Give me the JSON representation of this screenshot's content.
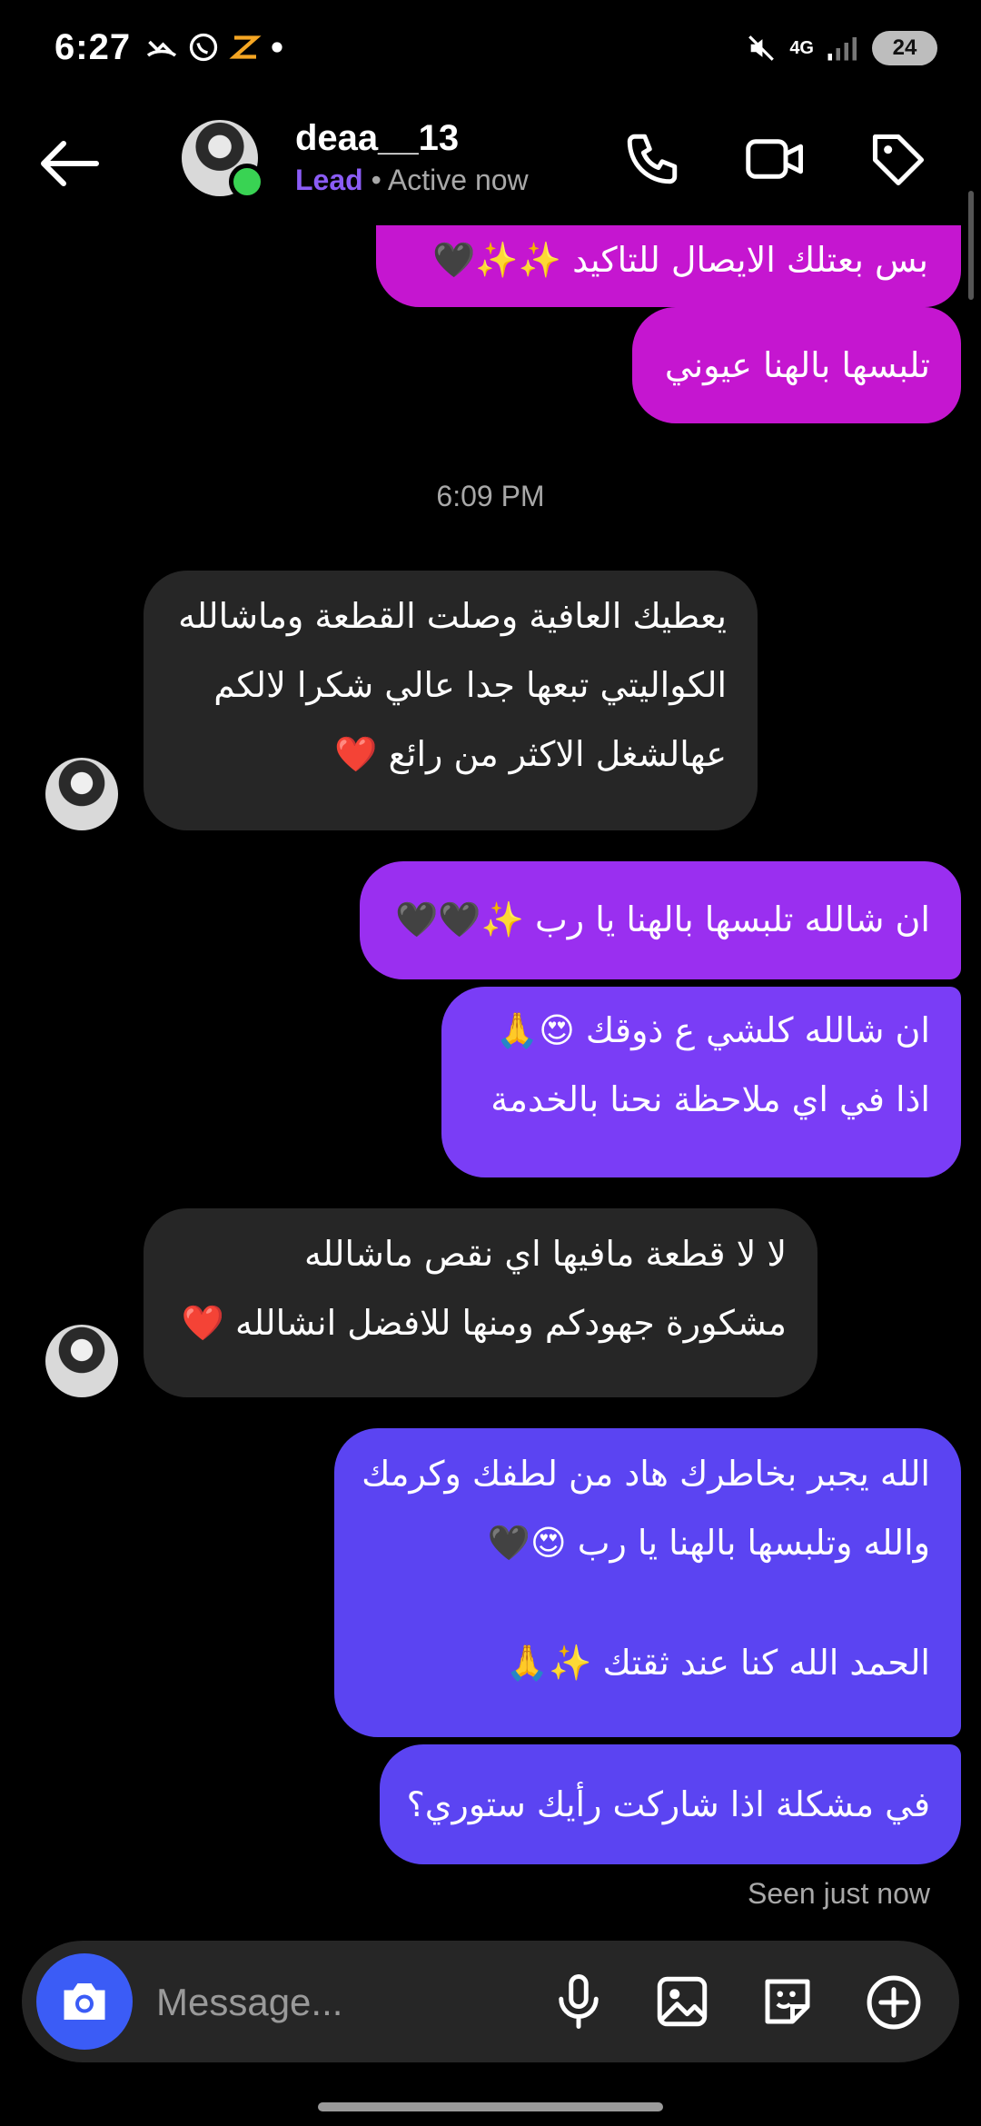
{
  "status_bar": {
    "time": "6:27",
    "network": "4G",
    "battery": "24"
  },
  "header": {
    "username": "deaa__13",
    "label": "Lead",
    "separator": "•",
    "status": "Active now"
  },
  "messages": [
    {
      "direction": "out",
      "text": "بس بعتلك الايصال للتاكيد ✨✨🖤"
    },
    {
      "direction": "out",
      "text": "تلبسها بالهنا عيوني"
    },
    {
      "type": "timestamp",
      "text": "6:09 PM"
    },
    {
      "direction": "in",
      "lines": [
        "يعطيك العافية وصلت القطعة وماشالله",
        "الكواليتي تبعها جدا عالي شكرا لالكم",
        "عهالشغل الاكثر من رائع ❤️"
      ]
    },
    {
      "direction": "out",
      "text": "ان شالله تلبسها بالهنا يا رب ✨🖤🖤"
    },
    {
      "direction": "out",
      "lines": [
        "ان شالله كلشي ع ذوقك 😍🙏",
        "اذا في اي ملاحظة نحنا بالخدمة"
      ]
    },
    {
      "direction": "in",
      "lines": [
        "لا لا قطعة مافيها اي نقص ماشالله",
        "مشكورة جهودكم ومنها للافضل انشالله ❤️"
      ]
    },
    {
      "direction": "out",
      "lines": [
        "الله يجبر بخاطرك هاد من لطفك وكرمك",
        "والله وتلبسها بالهنا يا رب 😍🖤",
        "",
        "الحمد الله كنا عند ثقتك ✨🙏"
      ]
    },
    {
      "direction": "out",
      "text": "في مشكلة اذا شاركت رأيك ستوري؟"
    }
  ],
  "seen": "Seen just now",
  "composer": {
    "placeholder": "Message..."
  },
  "colors": {
    "incoming": "#262626",
    "outgoing_pink": "#c516d0",
    "outgoing_purple": "#9a2ff0",
    "outgoing_violet": "#7a3df6",
    "outgoing_blue": "#5b44f2",
    "lead": "#8b5cf6",
    "online": "#39d353",
    "camera": "#3b5cf6"
  },
  "icons": [
    "back-arrow-icon",
    "phone-icon",
    "video-camera-icon",
    "tag-icon",
    "camera-icon",
    "microphone-icon",
    "gallery-icon",
    "sticker-icon",
    "plus-circle-icon"
  ]
}
